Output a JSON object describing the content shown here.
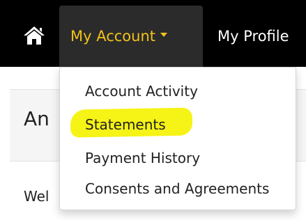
{
  "navbar": {
    "home_icon": "home-icon",
    "account_label": "My Account",
    "account_caret_icon": "caret-down-icon",
    "profile_label": "My Profile",
    "accent_color": "#f2c21c"
  },
  "dropdown": {
    "items": [
      {
        "label": "Account Activity"
      },
      {
        "label": "Statements",
        "highlighted": true
      },
      {
        "label": "Payment History"
      },
      {
        "label": "Consents and Agreements"
      }
    ],
    "highlight_color": "#f6f316"
  },
  "page": {
    "heading_partial": "An",
    "welcome_partial": "Wel"
  }
}
